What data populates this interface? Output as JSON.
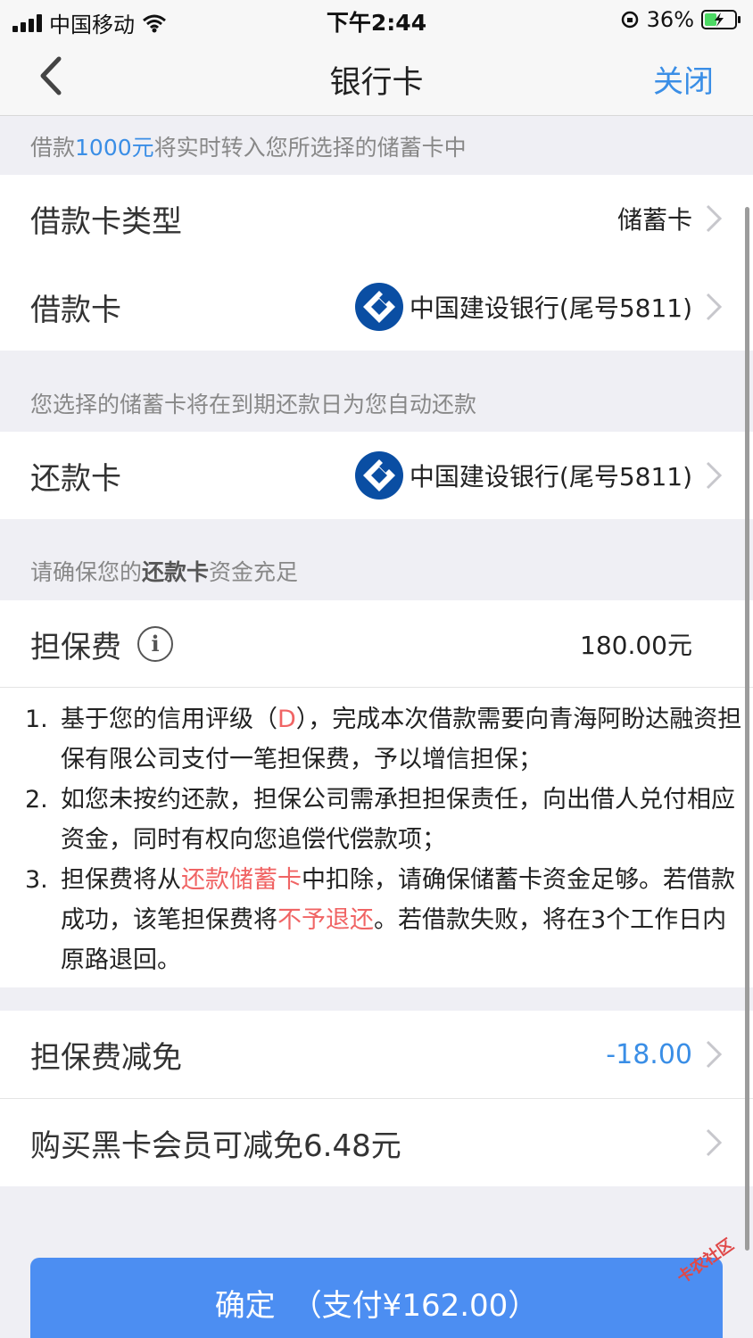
{
  "status_bar": {
    "carrier": "中国移动",
    "time": "下午2:44",
    "battery": "36%"
  },
  "nav": {
    "title": "银行卡",
    "close": "关闭"
  },
  "hint1": {
    "prefix": "借款",
    "amount": "1000元",
    "suffix": "将实时转入您所选择的储蓄卡中"
  },
  "rows": {
    "card_type": {
      "label": "借款卡类型",
      "value": "储蓄卡"
    },
    "loan_card": {
      "label": "借款卡",
      "value": "中国建设银行(尾号5811)"
    },
    "repay_card": {
      "label": "还款卡",
      "value": "中国建设银行(尾号5811)"
    }
  },
  "hint2": "您选择的储蓄卡将在到期还款日为您自动还款",
  "hint3": {
    "prefix": "请确保您的",
    "bold": "还款卡",
    "suffix": "资金充足"
  },
  "fee": {
    "label": "担保费",
    "info_icon": "i",
    "value": "180.00元"
  },
  "terms": [
    {
      "num": "1.",
      "p1": "基于您的信用评级（",
      "red": "D",
      "p2": "），完成本次借款需要向青海阿盼达融资担保有限公司支付一笔担保费，予以增信担保；"
    },
    {
      "num": "2.",
      "text": "如您未按约还款，担保公司需承担担保责任，向出借人兑付相应资金，同时有权向您追偿代偿款项；"
    },
    {
      "num": "3.",
      "p1": "担保费将从",
      "red1": "还款储蓄卡",
      "p2": "中扣除，请确保储蓄卡资金足够。若借款成功，该笔担保费将",
      "red2": "不予退还",
      "p3": "。若借款失败，将在3个工作日内原路退回。"
    }
  ],
  "discount": {
    "label": "担保费减免",
    "value": "-18.00"
  },
  "vip": {
    "label": "购买黑卡会员可减免6.48元"
  },
  "confirm": {
    "label": "确定",
    "pay": "（支付¥162.00）"
  },
  "watermark": "卡农社区",
  "colors": {
    "accent": "#3a8ee6",
    "button": "#4c8ef2",
    "warning": "#f06464"
  }
}
